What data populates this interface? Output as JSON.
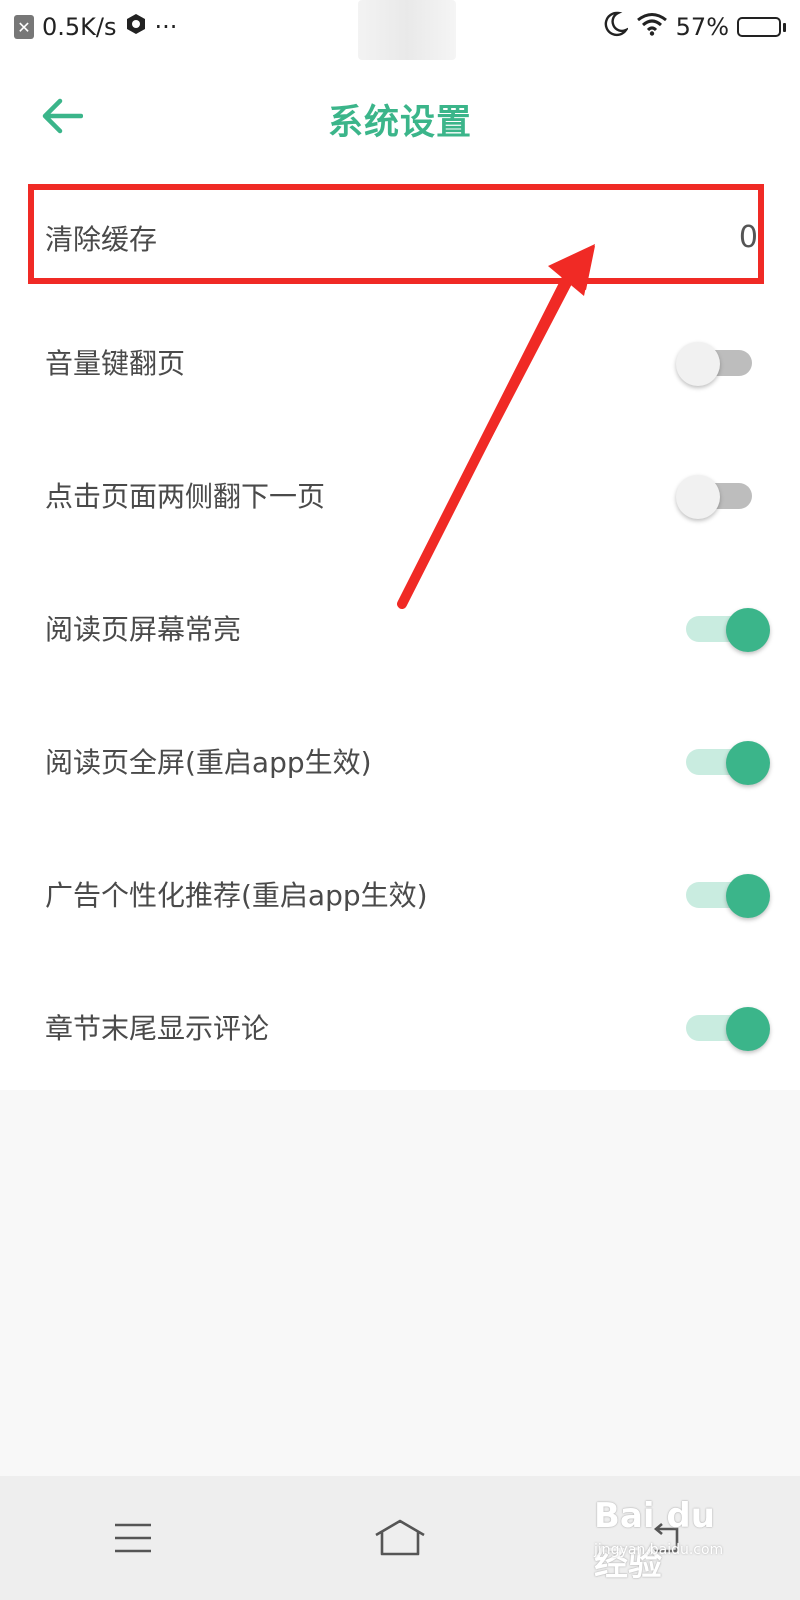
{
  "status_bar": {
    "net_speed": "0.5K/s",
    "more": "···",
    "battery": "57%",
    "battery_level": 0.57
  },
  "header": {
    "title": "系统设置"
  },
  "settings": {
    "clear_cache": {
      "label": "清除缓存",
      "value": "0"
    },
    "volume_key_page": {
      "label": "音量键翻页",
      "enabled": false
    },
    "tap_sides_next_page": {
      "label": "点击页面两侧翻下一页",
      "enabled": false
    },
    "screen_always_on": {
      "label": "阅读页屏幕常亮",
      "enabled": true
    },
    "fullscreen_reading": {
      "label": "阅读页全屏(重启app生效)",
      "enabled": true
    },
    "personalized_ads": {
      "label": "广告个性化推荐(重启app生效)",
      "enabled": true
    },
    "chapter_end_comments": {
      "label": "章节末尾显示评论",
      "enabled": true
    }
  },
  "watermark": {
    "main": "Bai du 经验",
    "sub": "jingyan.baidu.com"
  },
  "colors": {
    "accent": "#3bb58a",
    "annotation": "#f02a25"
  },
  "icons": {
    "back": "arrow-left-icon",
    "nav_menu": "menu-icon",
    "nav_home": "home-icon",
    "nav_back": "back-icon"
  }
}
